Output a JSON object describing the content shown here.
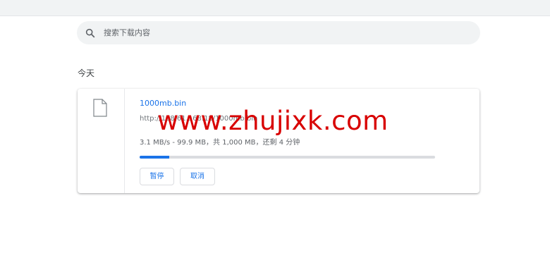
{
  "search": {
    "placeholder": "搜索下载内容"
  },
  "section": {
    "title": "今天"
  },
  "download": {
    "file_name": "1000mb.bin",
    "url": "http://198.61.168.18/1000mb.bin",
    "status": "3.1 MB/s - 99.9 MB，共 1,000 MB，还剩 4 分钟",
    "progress_fraction": 0.0999,
    "pause_label": "暂停",
    "cancel_label": "取消"
  },
  "watermark": {
    "text": "www.zhujixk.com"
  },
  "colors": {
    "accent": "#1a73e8",
    "watermark": "#d80000"
  },
  "icons": {
    "search": "search-icon",
    "file": "file-icon"
  }
}
